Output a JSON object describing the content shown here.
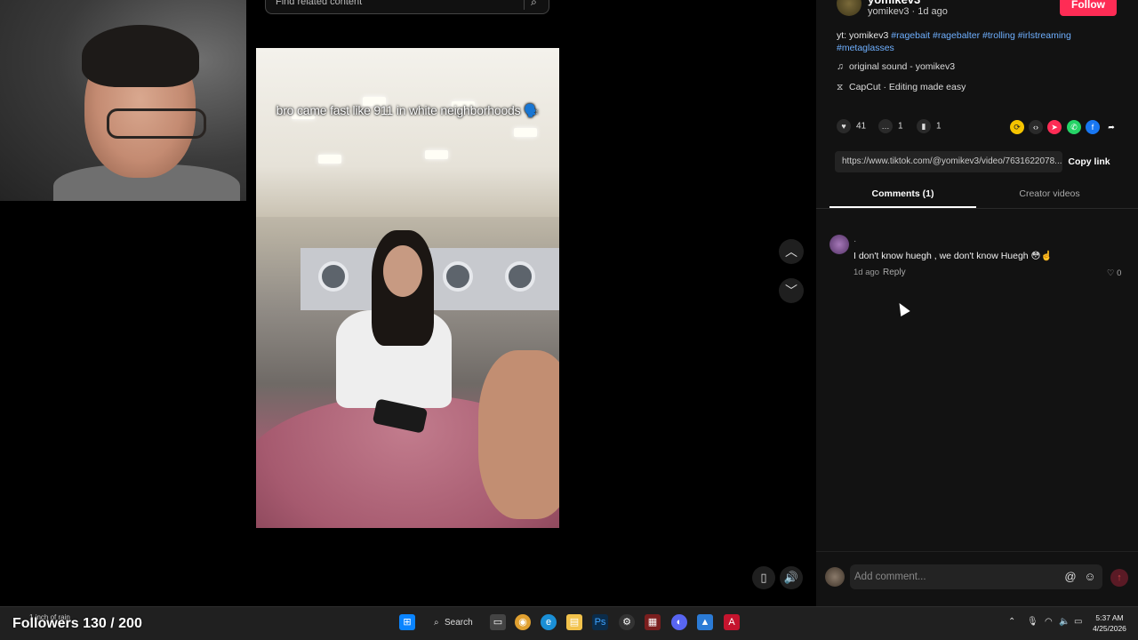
{
  "search": {
    "placeholder": "Find related content"
  },
  "video": {
    "caption": "bro came fast like 911 in white neighborhoods 🗣️"
  },
  "author": {
    "name": "yomikev3",
    "meta": "yomikev3 · 1d ago",
    "follow_label": "Follow"
  },
  "description": {
    "prefix": "yt: yomikev3 ",
    "tags": [
      "#ragebait",
      "#ragebalter",
      "#trolling",
      "#irlstreaming",
      "#metaglasses"
    ]
  },
  "sound": {
    "icon": "music-note-icon",
    "label": "original sound - yomikev3"
  },
  "capcut": {
    "icon": "capcut-icon",
    "label": "CapCut · Editing made easy"
  },
  "stats": {
    "likes": "41",
    "comments": "1",
    "saves": "1"
  },
  "share": {
    "link": "https://www.tiktok.com/@yomikev3/video/7631622078...",
    "copy_label": "Copy link"
  },
  "tabs": {
    "comments": "Comments (1)",
    "creator_videos": "Creator videos"
  },
  "comment": {
    "author_dot": "·",
    "text": "I don't know huegh , we don't know Huegh 😳☝️",
    "age": "1d ago",
    "reply_label": "Reply",
    "likes": "♡ 0"
  },
  "composer": {
    "placeholder": "Add comment..."
  },
  "overlay": {
    "followers": "Followers 130 / 200",
    "weather": "1 inch of rain"
  },
  "taskbar": {
    "search_label": "Search",
    "time": "5:37 AM",
    "date": "4/25/2026"
  },
  "colors": {
    "accent": "#fe2c55",
    "hashtag": "#6fb0ff",
    "background": "#000000",
    "panel": "#121212"
  }
}
